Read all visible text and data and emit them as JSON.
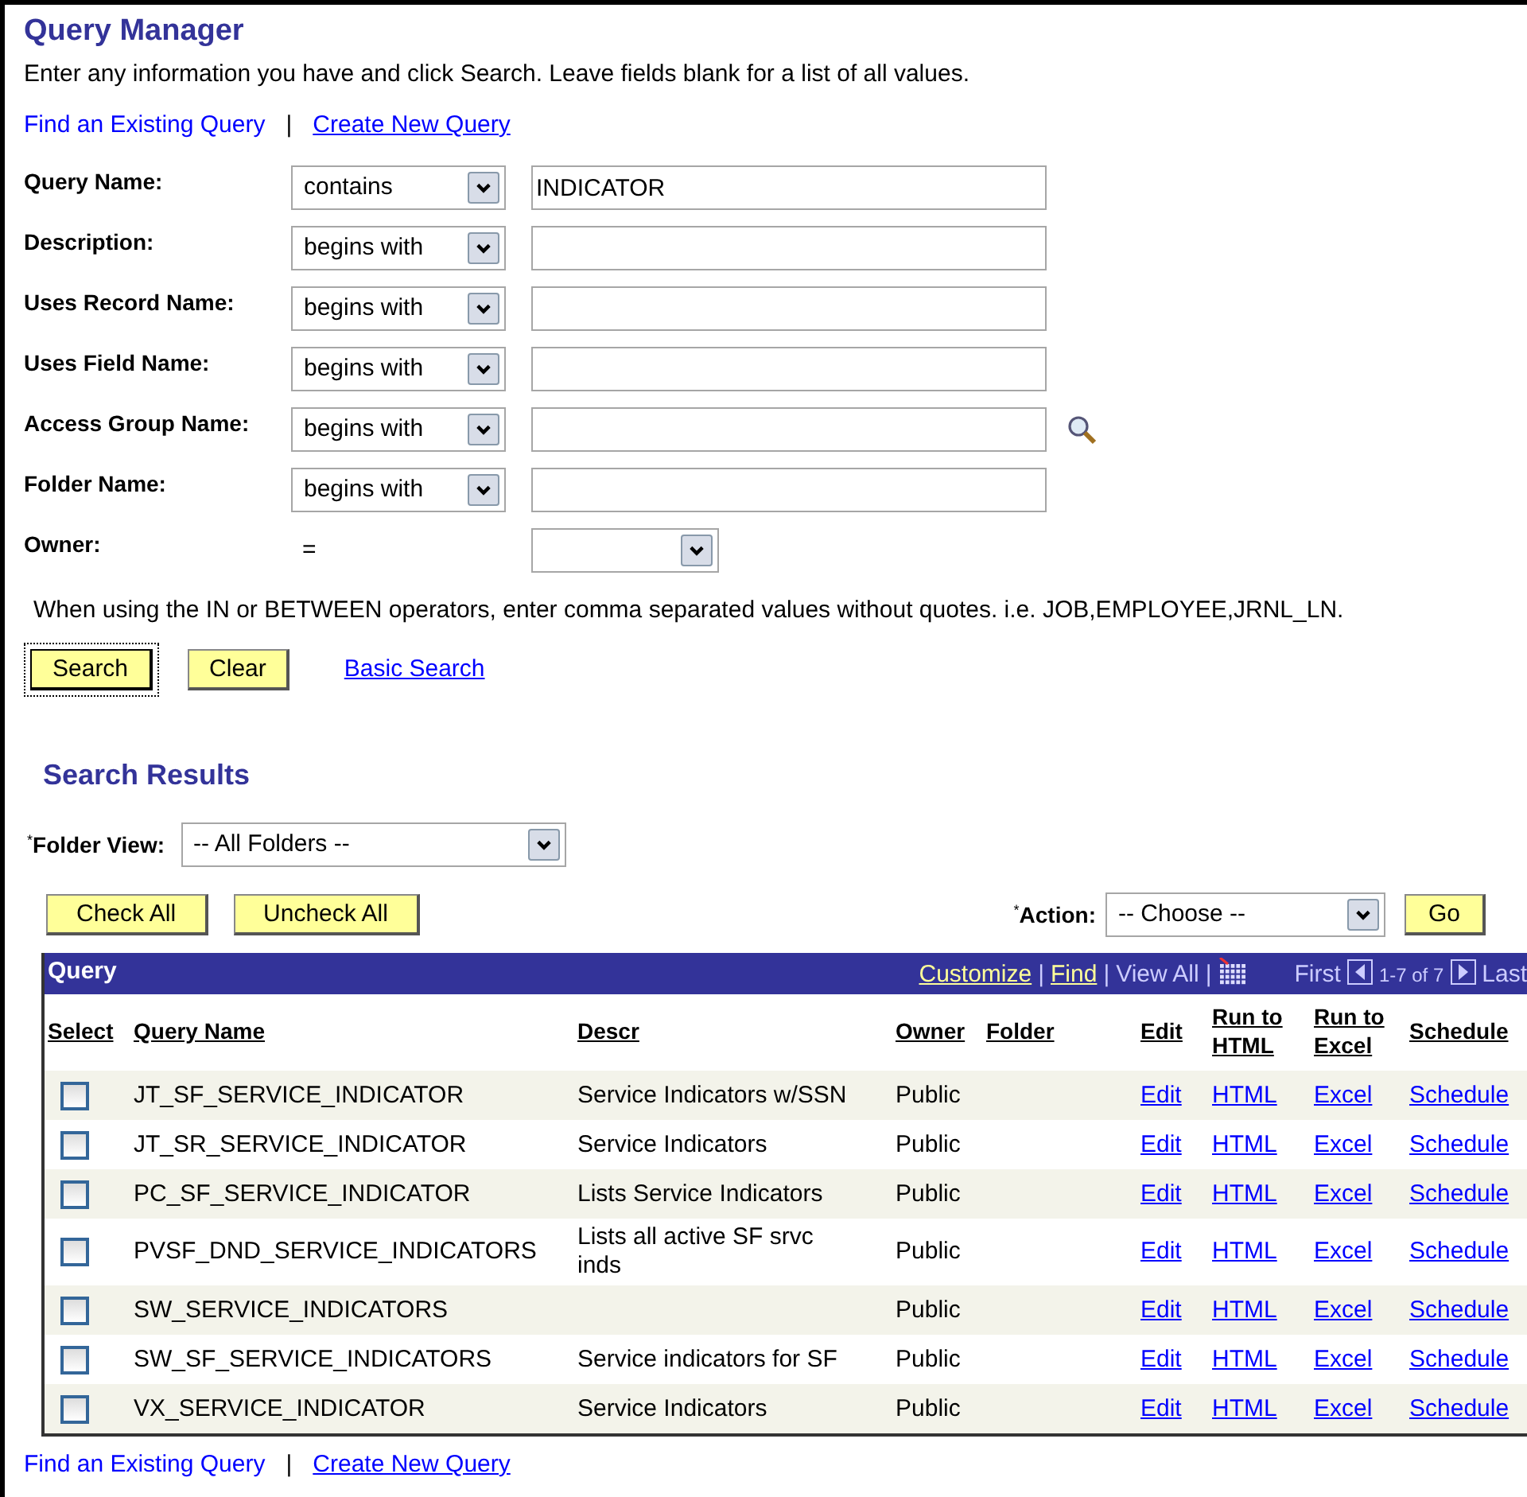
{
  "title": "Query Manager",
  "instructions": "Enter any information you have and click Search. Leave fields blank for a list of all values.",
  "top_links": [
    {
      "label": "Find an Existing Query",
      "selected": true
    },
    {
      "label": "Create New Query",
      "selected": false
    }
  ],
  "link_separator": "|",
  "criteria": [
    {
      "label": "Query Name:",
      "kind": "operator",
      "operator": "contains",
      "value": "INDICATOR"
    },
    {
      "label": "Description:",
      "kind": "operator",
      "operator": "begins with"
    },
    {
      "label": "Uses Record Name:",
      "kind": "operator",
      "operator": "begins with"
    },
    {
      "label": "Uses Field Name:",
      "kind": "operator",
      "operator": "begins with"
    },
    {
      "label": "Access Group Name:",
      "kind": "operator",
      "operator": "begins with",
      "lookup": true
    },
    {
      "label": "Folder Name:",
      "kind": "operator",
      "operator": "begins with"
    },
    {
      "label": "Owner:",
      "kind": "equals",
      "operator": "="
    }
  ],
  "hint": "When using the IN or BETWEEN operators, enter comma separated values without quotes. i.e. JOB,EMPLOYEE,JRNL_LN.",
  "buttons": [
    {
      "label": "Search",
      "focused": true
    },
    {
      "label": "Clear",
      "focused": false
    }
  ],
  "basic_search_link": "Basic Search",
  "results": {
    "title": "Search Results",
    "folder_view": {
      "label": "$^{*}$Folder View:",
      "value": "-- All Folders --"
    },
    "check_buttons": [
      "Check All",
      "Uncheck All"
    ],
    "action": {
      "label": "$^{*}$Action:",
      "value": "-- Choose --",
      "button": "Go"
    },
    "grid": {
      "title": "Query",
      "tools": [
        {
          "label": "Customize",
          "underlined": true
        },
        {
          "label": "Find",
          "underlined": true
        },
        {
          "label": "View All",
          "underlined": false
        }
      ],
      "tool_separator": "|",
      "pager": {
        "first": "First",
        "range": "1-7 of 7",
        "last": "Last"
      },
      "columns": [
        "Select",
        "Query Name",
        "Descr",
        "Owner",
        "Folder",
        "Edit",
        "Run to HTML",
        "Run to Excel",
        "Schedule"
      ],
      "rows": [
        {
          "checked": false,
          "query_name": "JT_SF_SERVICE_INDICATOR",
          "descr": "Service Indicators w/SSN",
          "owner": "Public",
          "edit": "Edit",
          "html": "HTML",
          "excel": "Excel",
          "schedule": "Schedule"
        },
        {
          "checked": false,
          "query_name": "JT_SR_SERVICE_INDICATOR",
          "descr": "Service Indicators",
          "owner": "Public",
          "edit": "Edit",
          "html": "HTML",
          "excel": "Excel",
          "schedule": "Schedule"
        },
        {
          "checked": false,
          "query_name": "PC_SF_SERVICE_INDICATOR",
          "descr": "Lists Service Indicators",
          "owner": "Public",
          "edit": "Edit",
          "html": "HTML",
          "excel": "Excel",
          "schedule": "Schedule"
        },
        {
          "checked": false,
          "query_name": "PVSF_DND_SERVICE_INDICATORS",
          "descr": "Lists all active SF srvc inds",
          "owner": "Public",
          "edit": "Edit",
          "html": "HTML",
          "excel": "Excel",
          "schedule": "Schedule"
        },
        {
          "checked": false,
          "query_name": "SW_SERVICE_INDICATORS",
          "owner": "Public",
          "edit": "Edit",
          "html": "HTML",
          "excel": "Excel",
          "schedule": "Schedule"
        },
        {
          "checked": false,
          "query_name": "SW_SF_SERVICE_INDICATORS",
          "descr": "Service indicators for SF",
          "owner": "Public",
          "edit": "Edit",
          "html": "HTML",
          "excel": "Excel",
          "schedule": "Schedule"
        },
        {
          "checked": false,
          "query_name": "VX_SERVICE_INDICATOR",
          "descr": "Service Indicators",
          "owner": "Public",
          "edit": "Edit",
          "html": "HTML",
          "excel": "Excel",
          "schedule": "Schedule"
        }
      ]
    }
  },
  "bottom_links": [
    {
      "label": "Find an Existing Query",
      "selected": true
    },
    {
      "label": "Create New Query",
      "selected": false
    }
  ]
}
